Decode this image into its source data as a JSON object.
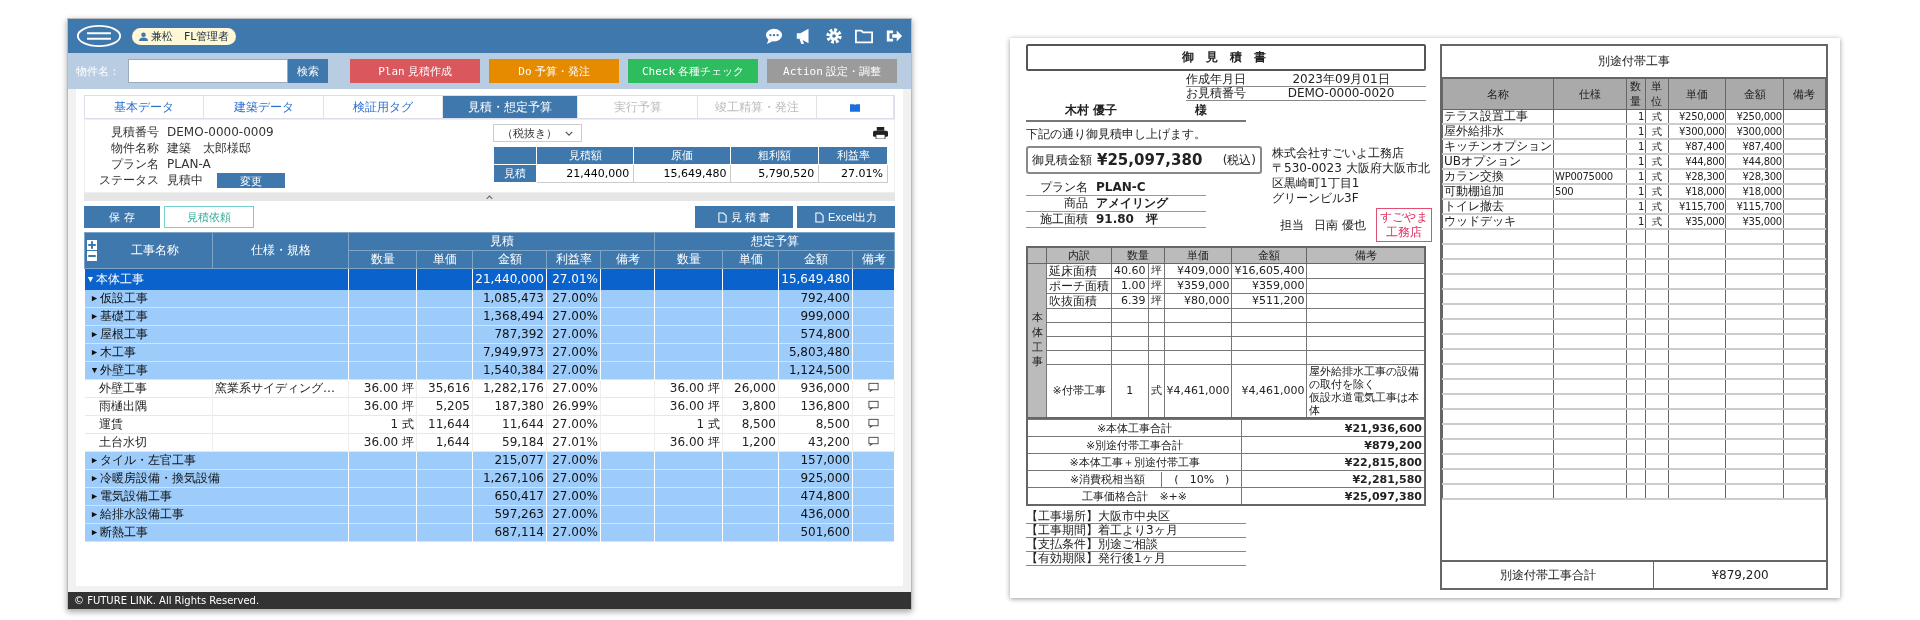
{
  "app": {
    "user_badge": "兼松　FL管理者",
    "search": {
      "label": "物件名：",
      "button": "検索"
    },
    "phases": [
      {
        "tag": "Plan",
        "label": "見積作成",
        "color": "#d9575d"
      },
      {
        "tag": "Do",
        "label": "予算・発注",
        "color": "#e68a00"
      },
      {
        "tag": "Check",
        "label": "各種チェック",
        "color": "#2dbd5e"
      },
      {
        "tag": "Action",
        "label": "設定・調整",
        "color": "#9b9b9b"
      }
    ],
    "tabs": [
      {
        "label": "基本データ",
        "selected": false,
        "disabled": false
      },
      {
        "label": "建築データ",
        "selected": false,
        "disabled": false
      },
      {
        "label": "検証用タグ",
        "selected": false,
        "disabled": false
      },
      {
        "label": "見積・想定予算",
        "selected": true,
        "disabled": false
      },
      {
        "label": "実行予算",
        "selected": false,
        "disabled": true
      },
      {
        "label": "竣工精算・発注",
        "selected": false,
        "disabled": true
      }
    ],
    "info": [
      {
        "label": "見積番号",
        "value": "DEMO-0000-0009"
      },
      {
        "label": "物件名称",
        "value": "建築　太郎様邸"
      },
      {
        "label": "プラン名",
        "value": "PLAN-A"
      }
    ],
    "status": {
      "label": "ステータス",
      "value": "見積中",
      "button": "変更"
    },
    "tax_select": "（税抜き）",
    "summary": {
      "columns": [
        "見積額",
        "原価",
        "粗利額",
        "利益率"
      ],
      "label": "見積",
      "values": [
        "21,440,000",
        "15,649,480",
        "5,790,520",
        "27.01%"
      ]
    },
    "actions": {
      "save": "保 存",
      "request": "見積依頼",
      "sheet": "見 積 書",
      "excel": "Excel出力"
    },
    "table": {
      "name": "工事名称",
      "spec": "仕様・規格",
      "estimate": "見積",
      "estimate_columns": [
        "数量",
        "単価",
        "金額",
        "利益率",
        "備考"
      ],
      "budget": "想定予算",
      "budget_columns": [
        "数量",
        "単価",
        "金額",
        "備考"
      ],
      "rows": [
        {
          "kind": "total",
          "name": "本体工事",
          "expanded": true,
          "amount": "21,440,000",
          "rate": "27.01%",
          "budget_amount": "15,649,480"
        },
        {
          "kind": "group",
          "name": "仮設工事",
          "expanded": false,
          "amount": "1,085,473",
          "rate": "27.00%",
          "budget_amount": "792,400"
        },
        {
          "kind": "group",
          "name": "基礎工事",
          "expanded": false,
          "amount": "1,368,494",
          "rate": "27.00%",
          "budget_amount": "999,000"
        },
        {
          "kind": "group",
          "name": "屋根工事",
          "expanded": false,
          "amount": "787,392",
          "rate": "27.00%",
          "budget_amount": "574,800"
        },
        {
          "kind": "group",
          "name": "木工事",
          "expanded": false,
          "amount": "7,949,973",
          "rate": "27.00%",
          "budget_amount": "5,803,480"
        },
        {
          "kind": "group",
          "name": "外壁工事",
          "expanded": true,
          "amount": "1,540,384",
          "rate": "27.00%",
          "budget_amount": "1,124,500"
        },
        {
          "kind": "item",
          "name": "外壁工事",
          "spec": "窯業系サイディング…",
          "qty": "36.00 坪",
          "price": "35,616",
          "amount": "1,282,176",
          "rate": "27.00%",
          "budget_qty": "36.00 坪",
          "budget_price": "26,000",
          "budget_amount": "936,000"
        },
        {
          "kind": "item",
          "name": "雨樋出隅",
          "qty": "36.00 坪",
          "price": "5,205",
          "amount": "187,380",
          "rate": "26.99%",
          "budget_qty": "36.00 坪",
          "budget_price": "3,800",
          "budget_amount": "136,800"
        },
        {
          "kind": "item",
          "name": "運賃",
          "qty": "1 式",
          "price": "11,644",
          "amount": "11,644",
          "rate": "27.00%",
          "budget_qty": "1 式",
          "budget_price": "8,500",
          "budget_amount": "8,500"
        },
        {
          "kind": "item",
          "name": "土台水切",
          "qty": "36.00 坪",
          "price": "1,644",
          "amount": "59,184",
          "rate": "27.01%",
          "budget_qty": "36.00 坪",
          "budget_price": "1,200",
          "budget_amount": "43,200"
        },
        {
          "kind": "group",
          "name": "タイル・左官工事",
          "expanded": false,
          "amount": "215,077",
          "rate": "27.00%",
          "budget_amount": "157,000"
        },
        {
          "kind": "group",
          "name": "冷暖房設備・換気設備",
          "expanded": false,
          "amount": "1,267,106",
          "rate": "27.00%",
          "budget_amount": "925,000"
        },
        {
          "kind": "group",
          "name": "電気設備工事",
          "expanded": false,
          "amount": "650,417",
          "rate": "27.00%",
          "budget_amount": "474,800"
        },
        {
          "kind": "group",
          "name": "給排水設備工事",
          "expanded": false,
          "amount": "597,263",
          "rate": "27.00%",
          "budget_amount": "436,000"
        },
        {
          "kind": "group",
          "name": "断熱工事",
          "expanded": false,
          "amount": "687,114",
          "rate": "27.00%",
          "budget_amount": "501,600"
        }
      ]
    },
    "footer": "© FUTURE LINK. All Rights Reserved."
  },
  "estimate_sheet": {
    "title": "御 見 積 書",
    "meta": [
      {
        "label": "作成年月日",
        "value": "2023年09月01日"
      },
      {
        "label": "お見積番号",
        "value": "DEMO-0000-0020"
      }
    ],
    "customer": "木村 優子",
    "honorific": "様",
    "greeting": "下記の通り御見積申し上げます。",
    "amount": {
      "label": "御見積金額",
      "value": "¥25,097,380",
      "note": "(税込)"
    },
    "company": [
      "株式会社すごいよ工務店",
      "〒530-0023 大阪府大阪市北区黒崎町1丁目1",
      "グリーンビル3F"
    ],
    "staff": {
      "label": "担当",
      "name": "日南 優也"
    },
    "stamp": [
      "すごやま",
      "工務店"
    ],
    "plan": [
      {
        "label": "プラン名",
        "value": "PLAN-C"
      },
      {
        "label": "商品",
        "value": "アメイリング"
      },
      {
        "label": "施工面積",
        "value": "91.80　坪"
      }
    ],
    "columns": [
      "内訳",
      "数量",
      "単価",
      "金額",
      "備考"
    ],
    "section": "本体工事",
    "rows": [
      {
        "name": "延床面積",
        "qty": "40.60",
        "unit": "坪",
        "price": "¥409,000",
        "amount": "¥16,605,400"
      },
      {
        "name": "ポーチ面積",
        "qty": "1.00",
        "unit": "坪",
        "price": "¥359,000",
        "amount": "¥359,000"
      },
      {
        "name": "吹抜面積",
        "qty": "6.39",
        "unit": "坪",
        "price": "¥80,000",
        "amount": "¥511,200"
      }
    ],
    "lump": {
      "name": "※付帯工事",
      "qty": "1",
      "unit": "式",
      "price": "¥4,461,000",
      "amount": "¥4,461,000",
      "notes": [
        "屋外給排水工事の設備の取付を除く",
        "仮設水道電気工事は本体"
      ]
    },
    "subtotal": {
      "label": "※本体工事合計",
      "value": "¥21,936,600"
    },
    "totals": [
      {
        "label": "※別途付帯工事合計",
        "value": "¥879,200"
      },
      {
        "label": "※本体工事＋別途付帯工事",
        "value": "¥22,815,800"
      },
      {
        "label": "※消費税相当額",
        "rate": "(　10%　)",
        "value": "¥2,281,580"
      },
      {
        "label": "工事価格合計　※+※",
        "value": "¥25,097,380"
      }
    ],
    "notes": [
      "【工事場所】大阪市中央区",
      "【工事期間】着工より3ヶ月",
      "【支払条件】別途ご相談",
      "【有効期限】発行後1ヶ月"
    ]
  },
  "extra_sheet": {
    "title": "別途付帯工事",
    "columns": [
      "名称",
      "仕様",
      "数量",
      "単位",
      "単価",
      "金額",
      "備考"
    ],
    "rows": [
      {
        "name": "テラス設置工事",
        "qty": "1",
        "unit": "式",
        "price": "¥250,000",
        "amount": "¥250,000"
      },
      {
        "name": "屋外給排水",
        "qty": "1",
        "unit": "式",
        "price": "¥300,000",
        "amount": "¥300,000"
      },
      {
        "name": "キッチンオプション",
        "qty": "1",
        "unit": "式",
        "price": "¥87,400",
        "amount": "¥87,400"
      },
      {
        "name": "UBオプション",
        "qty": "1",
        "unit": "式",
        "price": "¥44,800",
        "amount": "¥44,800"
      },
      {
        "name": "カラン交換",
        "spec": "WP0075000",
        "qty": "1",
        "unit": "式",
        "price": "¥28,300",
        "amount": "¥28,300"
      },
      {
        "name": "可動棚追加",
        "spec": "500",
        "qty": "1",
        "unit": "式",
        "price": "¥18,000",
        "amount": "¥18,000"
      },
      {
        "name": "トイレ撤去",
        "qty": "1",
        "unit": "式",
        "price": "¥115,700",
        "amount": "¥115,700"
      },
      {
        "name": "ウッドデッキ",
        "qty": "1",
        "unit": "式",
        "price": "¥35,000",
        "amount": "¥35,000"
      }
    ],
    "total": {
      "label": "別途付帯工事合計",
      "value": "¥879,200"
    }
  }
}
